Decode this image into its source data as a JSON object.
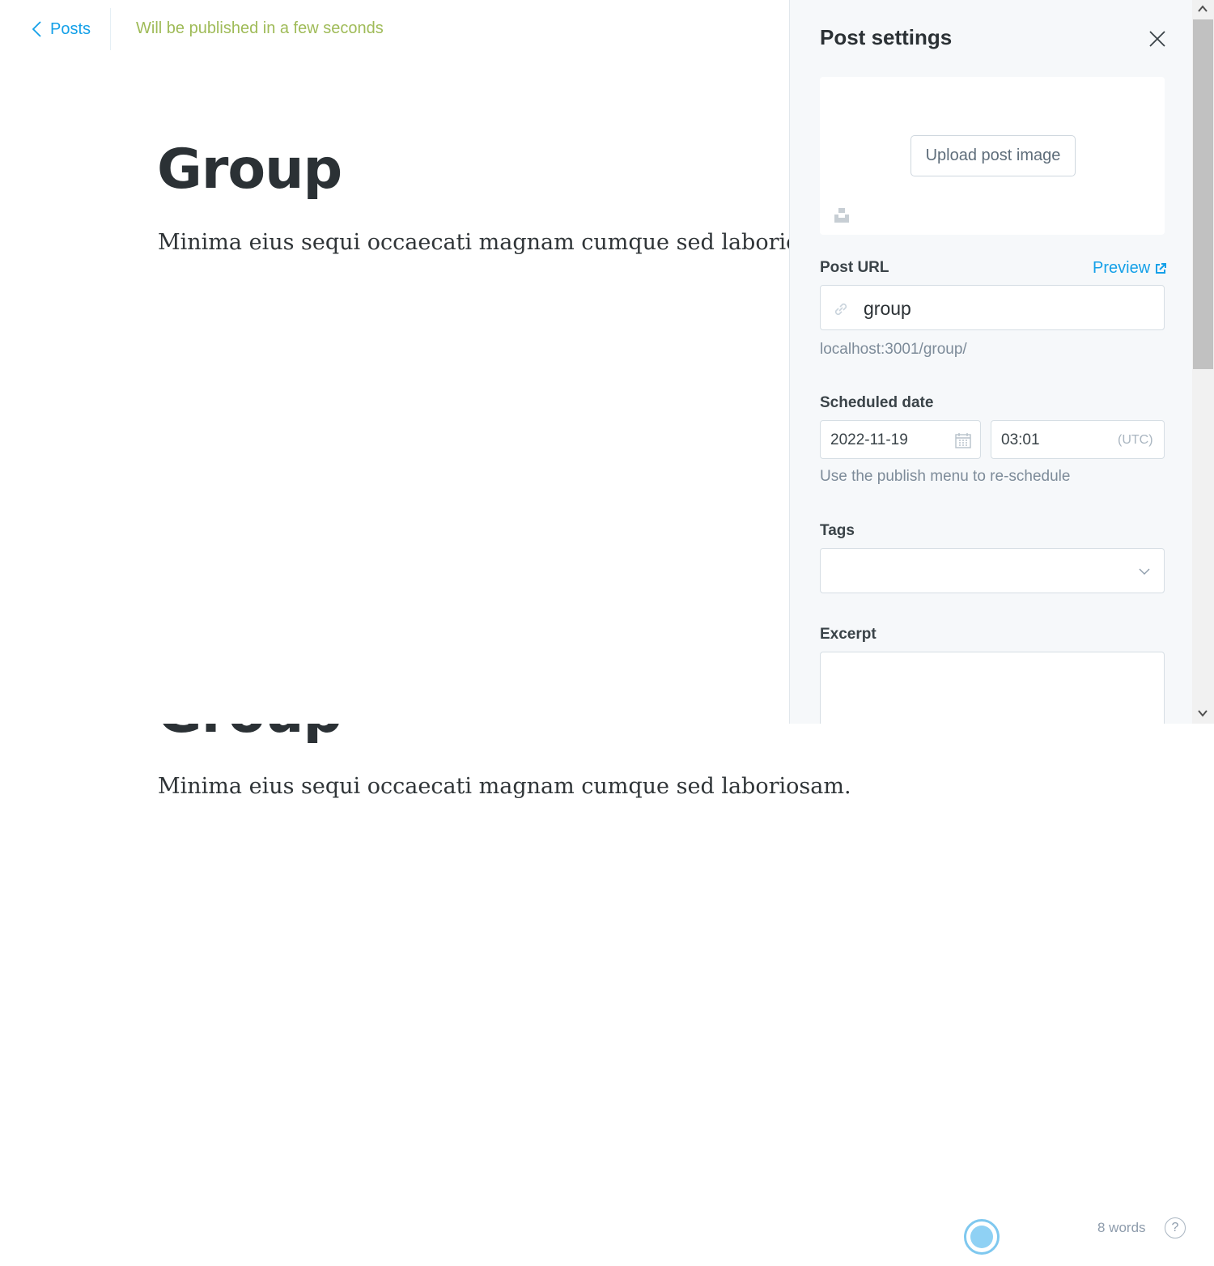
{
  "header": {
    "back_label": "Posts",
    "status_text": "Will be published in a few seconds"
  },
  "post": {
    "title": "Group",
    "body": "Minima eius sequi occaecati magnam cumque sed laboriosam."
  },
  "footer": {
    "word_count": "8 words",
    "help_label": "?"
  },
  "settings": {
    "title": "Post settings",
    "upload_label": "Upload post image",
    "post_url_label": "Post URL",
    "preview_label": "Preview",
    "slug": "group",
    "url_hint": "localhost:3001/group/",
    "scheduled_label": "Scheduled date",
    "date": "2022-11-19",
    "time": "03:01",
    "timezone": "(UTC)",
    "schedule_hint": "Use the publish menu to re-schedule",
    "tags_label": "Tags",
    "excerpt_label": "Excerpt"
  },
  "colors": {
    "accent": "#14a0e8",
    "status_green": "#9fbb58",
    "panel_bg": "#f6f8fa"
  },
  "icons": [
    "chevron-left-icon",
    "close-icon",
    "unsplash-icon",
    "external-link-icon",
    "link-icon",
    "calendar-icon",
    "chevron-down-icon",
    "help-icon"
  ]
}
